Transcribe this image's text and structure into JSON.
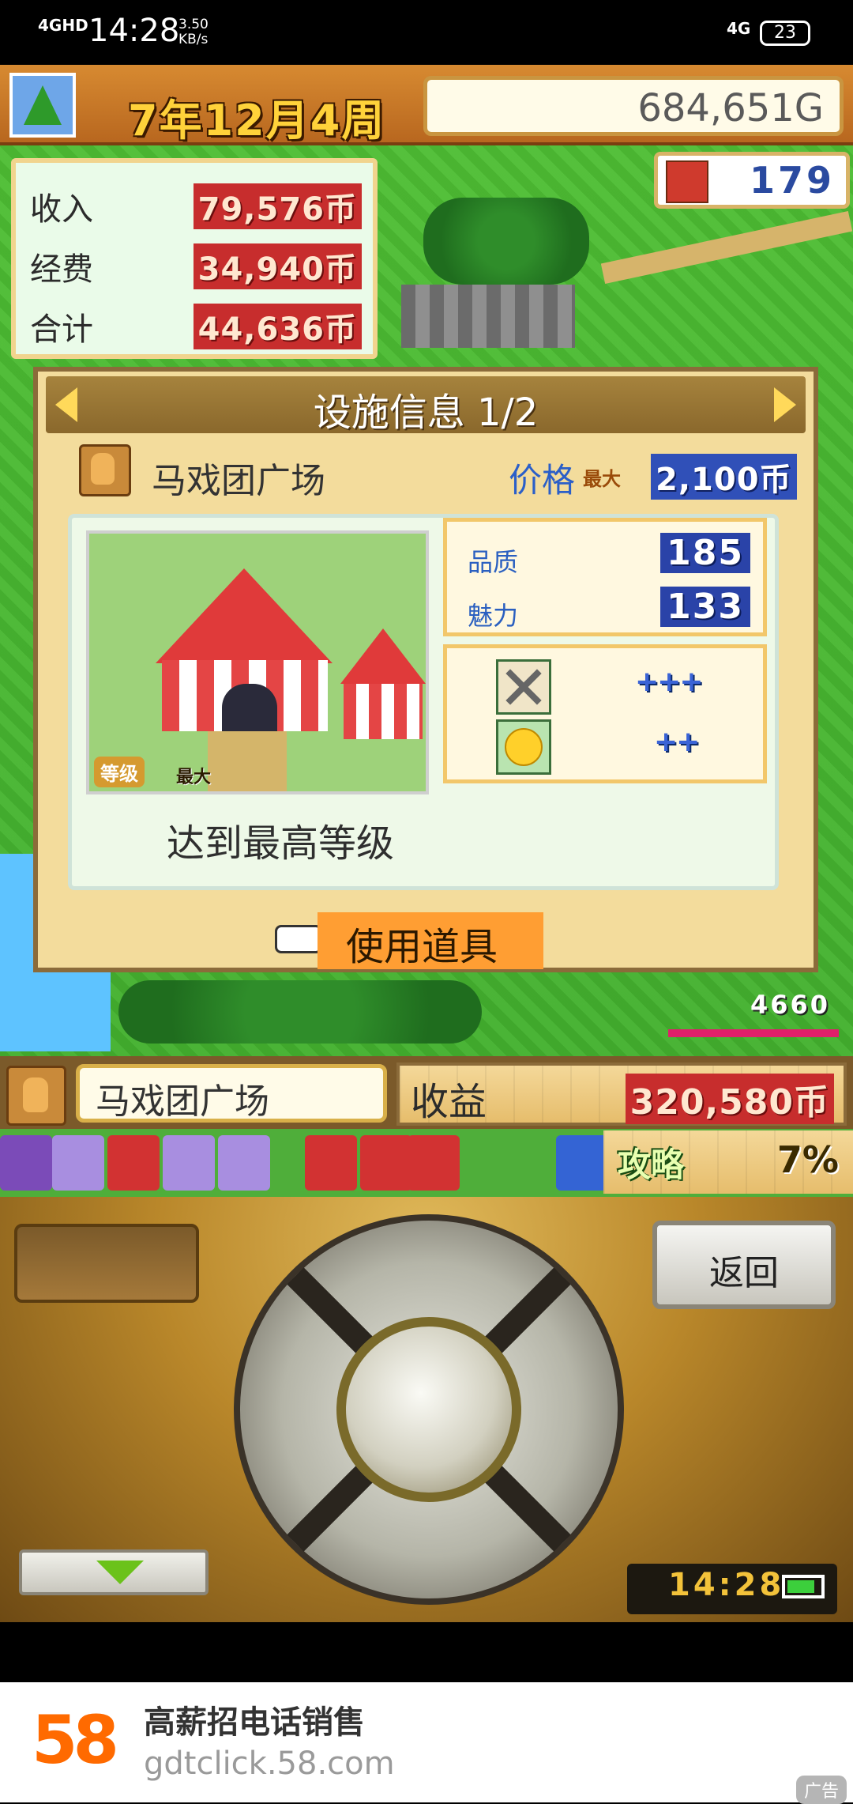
{
  "status_bar": {
    "network": "4GHD",
    "time": "14:28",
    "speed": "3.50\nKB/s",
    "network_right": "4G",
    "battery": "23"
  },
  "top_bar": {
    "date": "7年12月4周",
    "money": "684,651G",
    "population": "179"
  },
  "finance": {
    "rows": [
      {
        "label": "收入",
        "value": "79,576币"
      },
      {
        "label": "经费",
        "value": "34,940币"
      },
      {
        "label": "合计",
        "value": "44,636币"
      }
    ]
  },
  "facility_dialog": {
    "title": "设施信息 1/2",
    "name": "马戏团广场",
    "price_label": "价格",
    "price_max": "最大",
    "price_value": "2,100币",
    "level_badge": "等级",
    "level_max": "最大",
    "quality_label": "品质",
    "quality_value": "185",
    "charm_label": "魅力",
    "charm_value": "133",
    "attack_bonus": "+++",
    "happy_bonus": "++",
    "max_level_text": "达到最高等级",
    "use_item_label": "使用道具"
  },
  "floating_money": "4660",
  "selection_bar": {
    "name": "马戏团广场",
    "profit_label": "收益",
    "profit_value": "320,580币"
  },
  "strip": {
    "guide_label": "攻略",
    "guide_value": "7%"
  },
  "controller": {
    "back_label": "返回",
    "clock": "14:28"
  },
  "ad": {
    "logo": "58",
    "title": "高薪招电话销售",
    "url": "gdtclick.58.com",
    "tag": "广告"
  },
  "colors": {
    "accent_orange": "#ff9e33",
    "money_red": "#c72d2d",
    "stat_blue": "#2a43a8"
  }
}
